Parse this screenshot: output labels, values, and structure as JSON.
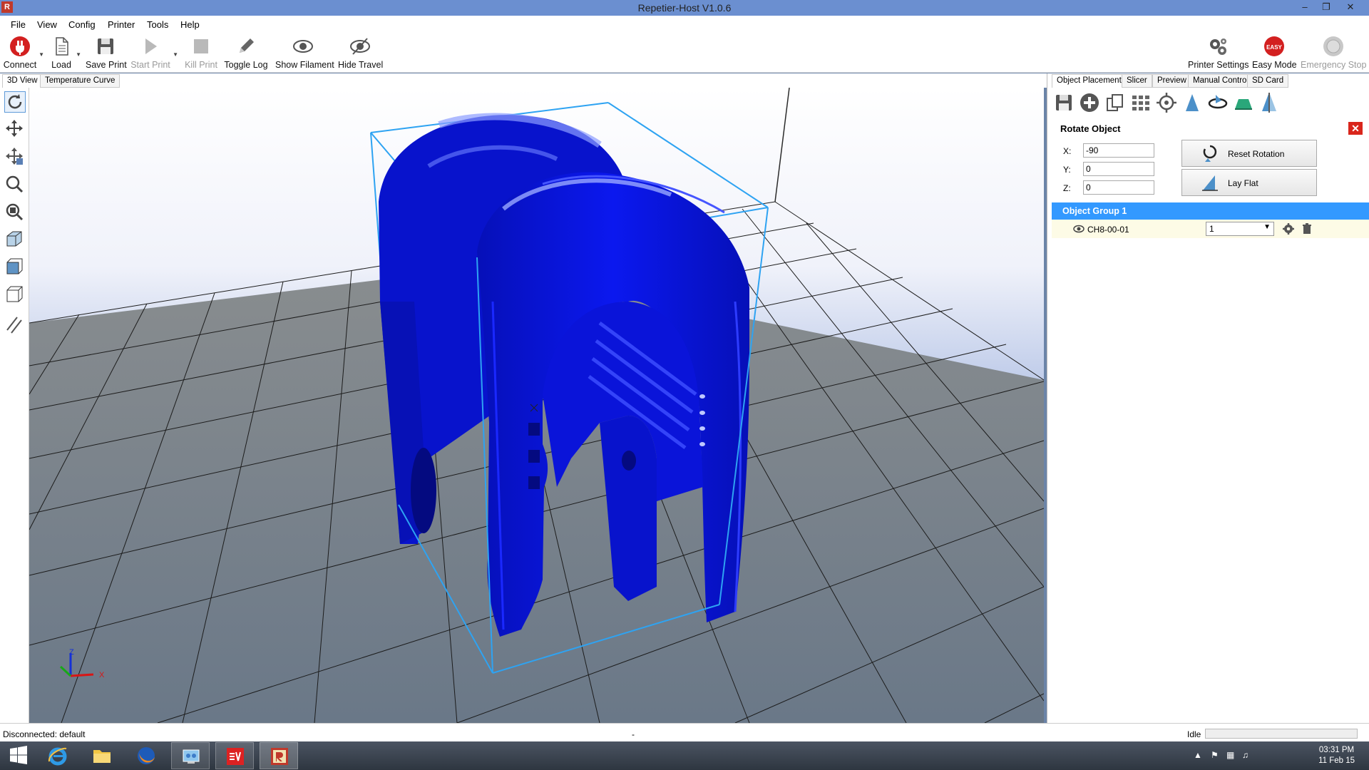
{
  "window": {
    "title": "Repetier-Host V1.0.6",
    "app_icon": "R"
  },
  "menu": [
    "File",
    "View",
    "Config",
    "Printer",
    "Tools",
    "Help"
  ],
  "toolbar": {
    "connect": "Connect",
    "load": "Load",
    "save_print": "Save Print",
    "start_print": "Start Print",
    "kill_print": "Kill Print",
    "toggle_log": "Toggle Log",
    "show_filament": "Show Filament",
    "hide_travel": "Hide Travel",
    "printer_settings": "Printer Settings",
    "easy_mode": "Easy Mode",
    "easy_badge": "EASY",
    "emergency_stop": "Emergency Stop"
  },
  "view_tabs": [
    "3D View",
    "Temperature Curve"
  ],
  "right_tabs": [
    "Object Placement",
    "Slicer",
    "Preview",
    "Manual Control",
    "SD Card"
  ],
  "rotate": {
    "title": "Rotate Object",
    "x_label": "X:",
    "x_value": "-90",
    "y_label": "Y:",
    "y_value": "0",
    "z_label": "Z:",
    "z_value": "0",
    "reset_rotation": "Reset Rotation",
    "lay_flat": "Lay Flat"
  },
  "objects": {
    "group": "Object Group 1",
    "item_name": "CH8-00-01",
    "copies": "1"
  },
  "status": {
    "left": "Disconnected: default",
    "center": "-",
    "right": "Idle"
  },
  "taskbar": {
    "time": "03:31 PM",
    "date": "11 Feb 15"
  },
  "axis_labels": {
    "x": "X",
    "z": "Z"
  },
  "colors": {
    "model": "#0a14e0",
    "selection": "#2ea3f2",
    "group_highlight": "#3399ff",
    "titlebar": "#6b8fd0"
  }
}
